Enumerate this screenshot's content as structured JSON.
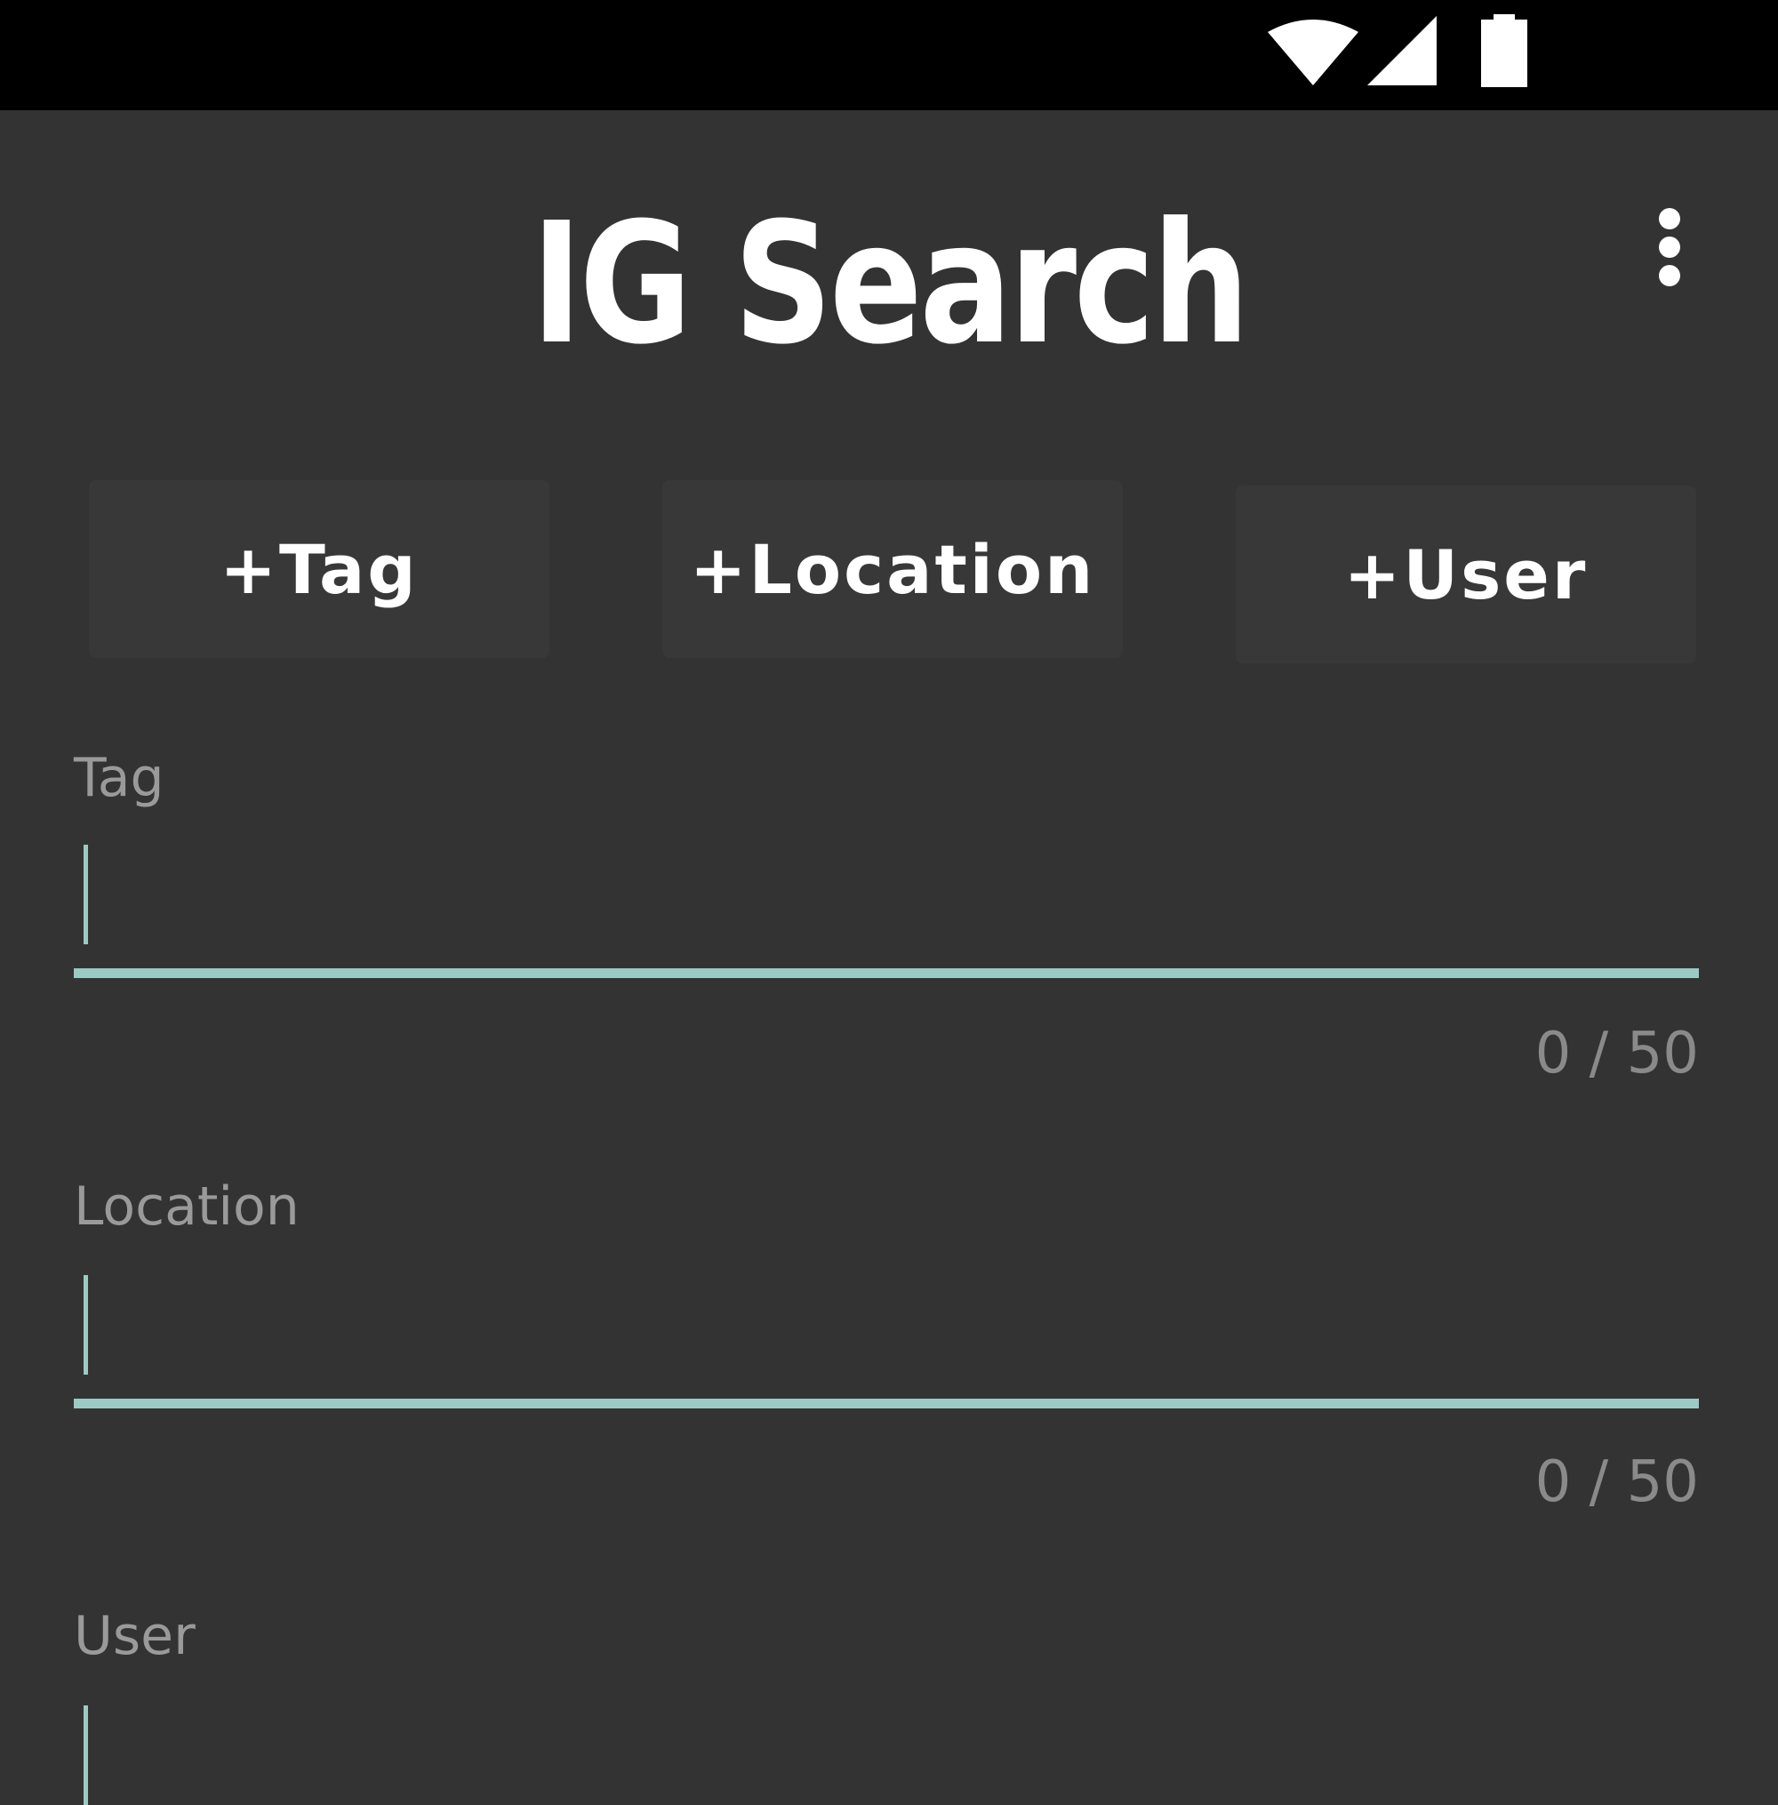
{
  "status_bar": {
    "icons": [
      "wifi-icon",
      "cellular-signal-icon",
      "battery-icon"
    ],
    "background": "#000000"
  },
  "header": {
    "title": "IG Search",
    "menu_icon": "more-vert-icon"
  },
  "actions": {
    "add_tag": "+Tag",
    "add_location": "+Location",
    "add_user": "+User"
  },
  "fields": {
    "tag": {
      "label": "Tag",
      "value": "",
      "counter": "0 / 50",
      "max_length": 50
    },
    "location": {
      "label": "Location",
      "value": "",
      "counter": "0 / 50",
      "max_length": 50
    },
    "user": {
      "label": "User",
      "value": ""
    }
  },
  "colors": {
    "background": "#333333",
    "accent": "#9ccac4",
    "button": "#383838",
    "label": "#9a9a9a",
    "text": "#ffffff"
  }
}
